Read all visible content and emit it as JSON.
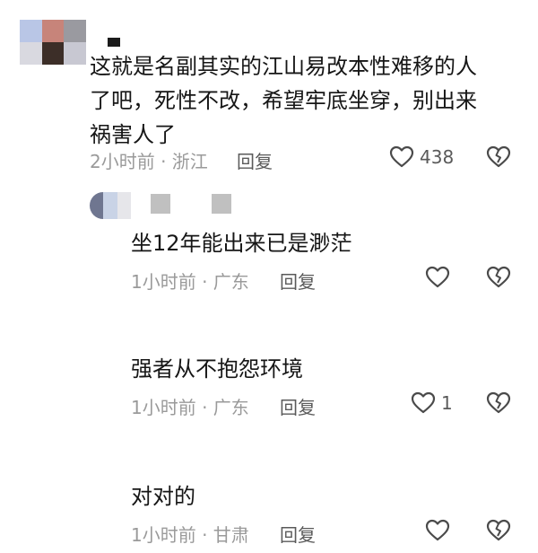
{
  "comments": [
    {
      "text": "这就是名副其实的江山易改本性难移的人\n了吧，死性不改，希望牢底坐穿，别出来\n祸害人了",
      "time": "2小时前 · 浙江",
      "reply_label": "回复",
      "likes": "438",
      "avatar_colors": [
        "#b9c6e6",
        "#c7847a",
        "#9a9aa0",
        "#d9d9e0",
        "#3c2e28",
        "#c8c8d2"
      ],
      "name_colors": [
        "#1b1b1b"
      ]
    },
    {
      "text": "坐12年能出来已是渺茫",
      "time": "1小时前 · 广东",
      "reply_label": "回复",
      "likes": "",
      "avatar_colors": [
        "#8f8a70",
        "#d7827a",
        "#eaa4a2"
      ],
      "name_colors": [
        "#b0b0b0",
        "#e6e6ea"
      ]
    },
    {
      "text": "强者从不抱怨环境",
      "time": "1小时前 · 广东",
      "reply_label": "回复",
      "likes": "1",
      "avatar_colors": [
        "#6a6a6a",
        "#bdbdbd",
        "#dedede"
      ],
      "name_colors": [
        "#cfcfcf",
        "#9e9e9e"
      ]
    },
    {
      "text": "对对的",
      "time": "1小时前 · 甘肃",
      "reply_label": "回复",
      "likes": "",
      "avatar_colors": [
        "#6f7690",
        "#c9d3e6",
        "#e6e6ea"
      ],
      "name_colors": [
        "#c0c0c0"
      ]
    }
  ],
  "icons": {
    "like": "heart-outline-icon",
    "dislike": "broken-heart-icon"
  }
}
